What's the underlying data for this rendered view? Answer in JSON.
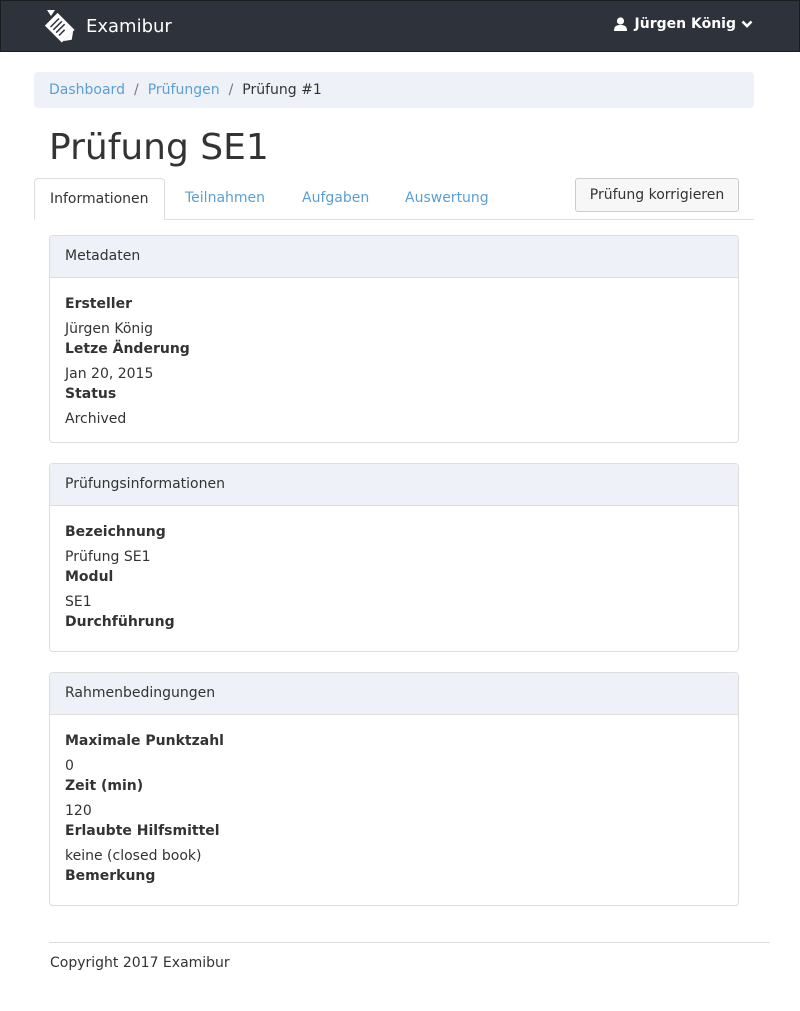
{
  "navbar": {
    "brand": "Examibur",
    "user": "Jürgen König"
  },
  "breadcrumb": {
    "items": [
      "Dashboard",
      "Prüfungen"
    ],
    "active": "Prüfung #1"
  },
  "page": {
    "title": "Prüfung SE1"
  },
  "tabs": [
    {
      "label": "Informationen",
      "active": true
    },
    {
      "label": "Teilnahmen",
      "active": false
    },
    {
      "label": "Aufgaben",
      "active": false
    },
    {
      "label": "Auswertung",
      "active": false
    }
  ],
  "actions": {
    "correct_label": "Prüfung korrigieren"
  },
  "panels": {
    "metadata": {
      "heading": "Metadaten",
      "fields": [
        {
          "label": "Ersteller",
          "value": "Jürgen König"
        },
        {
          "label": "Letze Änderung",
          "value": "Jan 20, 2015"
        },
        {
          "label": "Status",
          "value": "Archived"
        }
      ]
    },
    "exam_info": {
      "heading": "Prüfungsinformationen",
      "fields": [
        {
          "label": "Bezeichnung",
          "value": "Prüfung SE1"
        },
        {
          "label": "Modul",
          "value": "SE1"
        },
        {
          "label": "Durchführung",
          "value": ""
        }
      ]
    },
    "conditions": {
      "heading": "Rahmenbedingungen",
      "fields": [
        {
          "label": "Maximale Punktzahl",
          "value": "0"
        },
        {
          "label": "Zeit (min)",
          "value": "120"
        },
        {
          "label": "Erlaubte Hilfsmittel",
          "value": "keine (closed book)"
        },
        {
          "label": "Bemerkung",
          "value": ""
        }
      ]
    }
  },
  "footer": {
    "text": "Copyright 2017 Examibur"
  }
}
